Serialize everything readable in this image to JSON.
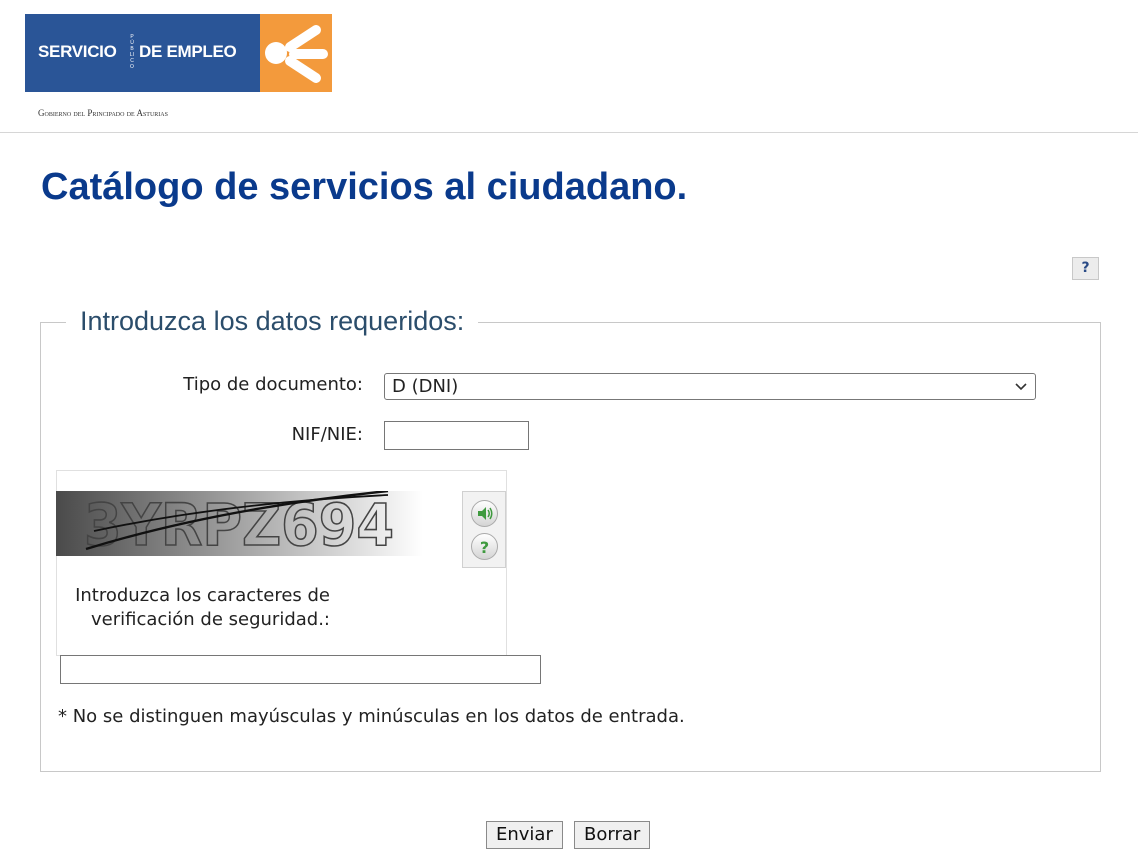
{
  "header": {
    "logo_left": "SERVICIO",
    "logo_vertical": "PÚBLICO",
    "logo_right": "DE EMPLEO",
    "gov_text": "Gobierno del Principado de Asturias",
    "logo_blue": "#2a5597",
    "logo_orange": "#f39a3c"
  },
  "main": {
    "title": "Catálogo de servicios al ciudadano.",
    "help_label": "?",
    "legend": "Introduzca los datos requeridos:",
    "doc_type_label": "Tipo de documento:",
    "doc_type_value": "D (DNI)",
    "nif_label": "NIF/NIE:",
    "nif_value": "",
    "captcha_text": "3YRPZ694",
    "captcha_label": "Introduzca los caracteres de verificación de seguridad.:",
    "captcha_value": "",
    "note": "* No se distinguen mayúsculas y minúsculas en los datos de entrada.",
    "submit_label": "Enviar",
    "reset_label": "Borrar"
  },
  "icons": {
    "audio": "speaker-icon",
    "help": "question-icon",
    "chevron": "chevron-down-icon"
  }
}
